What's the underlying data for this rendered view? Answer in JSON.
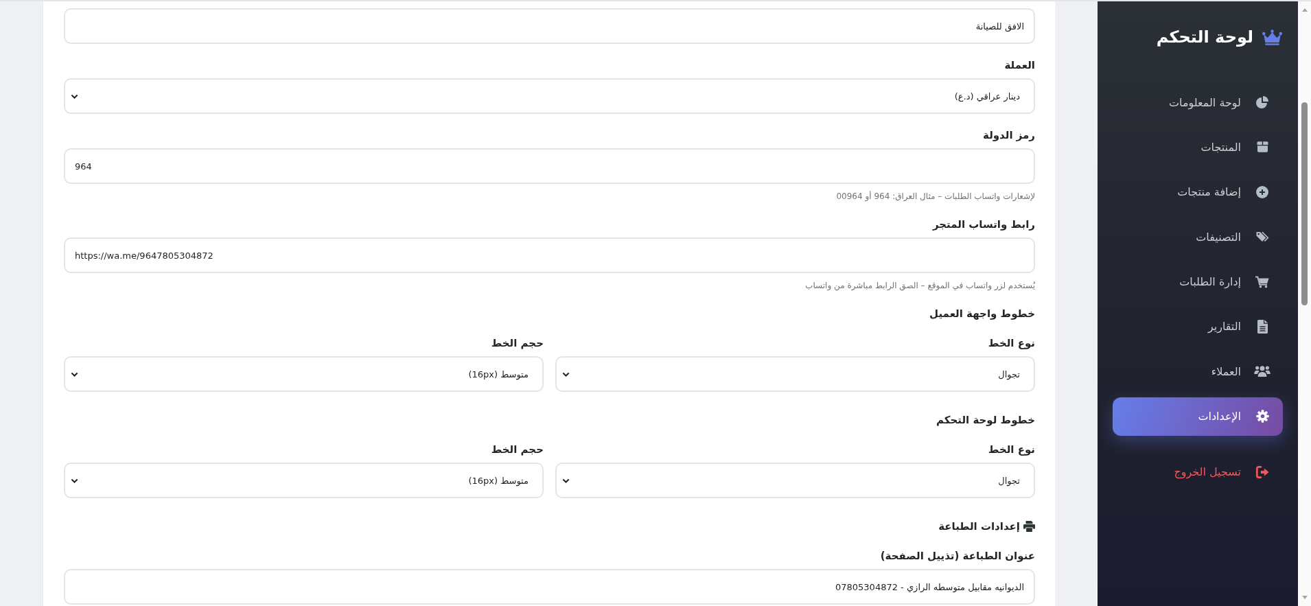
{
  "sidebar": {
    "title": "لوحة التحكم",
    "items": [
      {
        "label": "لوحة المعلومات",
        "kind": "link",
        "selected": false
      },
      {
        "label": "المنتجات",
        "kind": "link",
        "selected": false
      },
      {
        "label": "إضافة منتجات",
        "kind": "link",
        "selected": false
      },
      {
        "label": "التصنيفات",
        "kind": "link",
        "selected": false
      },
      {
        "label": "إدارة الطلبات",
        "kind": "link",
        "selected": false
      },
      {
        "label": "التقارير",
        "kind": "link",
        "selected": false
      },
      {
        "label": "العملاء",
        "kind": "link",
        "selected": false
      },
      {
        "label": "الإعدادات",
        "kind": "link",
        "selected": true
      },
      {
        "label": "تسجيل الخروج",
        "kind": "logout",
        "selected": false
      }
    ]
  },
  "form": {
    "fields": [
      {
        "kind": "text",
        "value": "الافق للصيانة"
      },
      {
        "kind": "select",
        "label": "العملة",
        "value": "دينار عراقي (د.ع)"
      },
      {
        "kind": "text",
        "label": "رمز الدولة",
        "value": "964",
        "hint": "لإشعارات واتساب الطلبات – مثال العراق: 964 أو 00964"
      },
      {
        "kind": "text",
        "label": "رابط واتساب المتجر",
        "value": "https://wa.me/9647805304872",
        "hint": "يُستخدم لزر واتساب في الموقع – الصق الرابط مباشرة من واتساب"
      },
      {
        "kind": "heading",
        "text": "خطوط واجهة العميل"
      },
      {
        "kind": "row",
        "fields": [
          {
            "kind": "select",
            "label": "نوع الخط",
            "value": "تجوال"
          },
          {
            "kind": "select",
            "label": "حجم الخط",
            "value": "متوسط (16px)"
          }
        ]
      },
      {
        "kind": "heading",
        "text": "خطوط لوحة التحكم"
      },
      {
        "kind": "row",
        "fields": [
          {
            "kind": "select",
            "label": "نوع الخط",
            "value": "تجوال"
          },
          {
            "kind": "select",
            "label": "حجم الخط",
            "value": "متوسط (16px)"
          }
        ]
      },
      {
        "kind": "print-heading",
        "text": "إعدادات الطباعة"
      },
      {
        "kind": "text",
        "label": "عنوان الطباعة (تذييل الصفحة)",
        "value": "الديوانيه مقابيل متوسطه الرازي - 07805304872"
      }
    ]
  }
}
